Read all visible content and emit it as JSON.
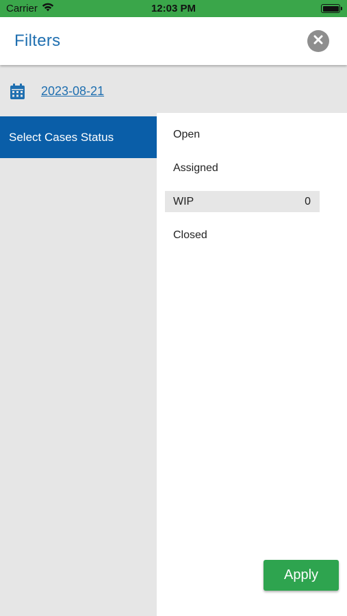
{
  "status_bar": {
    "carrier": "Carrier",
    "time": "12:03 PM",
    "wifi_icon": "wifi-icon",
    "battery_icon": "battery-icon"
  },
  "header": {
    "title": "Filters",
    "close_icon": "close-icon"
  },
  "date_filter": {
    "icon": "calendar-icon",
    "date": "2023-08-21"
  },
  "sidebar": {
    "items": [
      {
        "label": "Select Cases Status",
        "active": true
      }
    ]
  },
  "status_options": [
    {
      "label": "Open",
      "count": ""
    },
    {
      "label": "Assigned",
      "count": ""
    },
    {
      "label": "WIP",
      "count": "0",
      "selected": true
    },
    {
      "label": "Closed",
      "count": ""
    }
  ],
  "actions": {
    "apply_label": "Apply"
  },
  "colors": {
    "status_bar": "#3aa64a",
    "accent": "#1f6fb0",
    "sidebar_active": "#0a5ea8",
    "panel_gray": "#e6e6e6",
    "apply_button": "#2ea44f",
    "close_button": "#8e8e8e"
  }
}
